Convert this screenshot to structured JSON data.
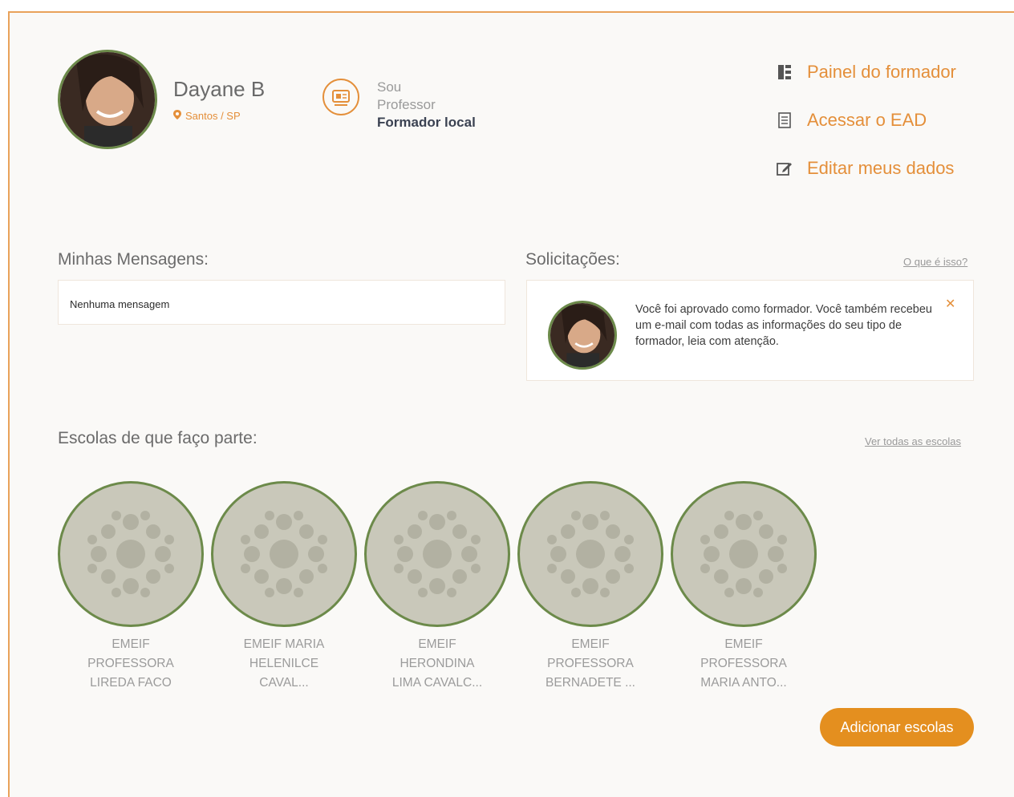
{
  "profile": {
    "name": "Dayane B",
    "location": "Santos / SP",
    "role_line1": "Sou",
    "role_line2": "Professor",
    "role_line3": "Formador local"
  },
  "menu": [
    {
      "label": "Painel do formador",
      "icon": "panel-icon"
    },
    {
      "label": "Acessar o EAD",
      "icon": "document-icon"
    },
    {
      "label": "Editar meus dados",
      "icon": "edit-icon"
    }
  ],
  "messages": {
    "title": "Minhas Mensagens:",
    "empty": "Nenhuma mensagem"
  },
  "requests": {
    "title": "Solicitações:",
    "help_link": "O que é isso?",
    "item_text": "Você foi aprovado como formador. Você também recebeu um e-mail com todas as informações do seu tipo de formador, leia com atenção."
  },
  "schools": {
    "title": "Escolas de que faço parte:",
    "see_all": "Ver todas as escolas",
    "items": [
      {
        "line1": "EMEIF",
        "line2": "PROFESSORA",
        "line3": "LIREDA FACO"
      },
      {
        "line1": "EMEIF MARIA",
        "line2": "HELENILCE",
        "line3": "CAVAL..."
      },
      {
        "line1": "EMEIF",
        "line2": "HERONDINA",
        "line3": "LIMA CAVALC..."
      },
      {
        "line1": "EMEIF",
        "line2": "PROFESSORA",
        "line3": "BERNADETE ..."
      },
      {
        "line1": "EMEIF",
        "line2": "PROFESSORA",
        "line3": "MARIA ANTO..."
      }
    ],
    "add_button": "Adicionar escolas"
  },
  "colors": {
    "accent": "#e48f3a",
    "green_border": "#6c8a4a",
    "school_bg": "#c9c8ba"
  }
}
